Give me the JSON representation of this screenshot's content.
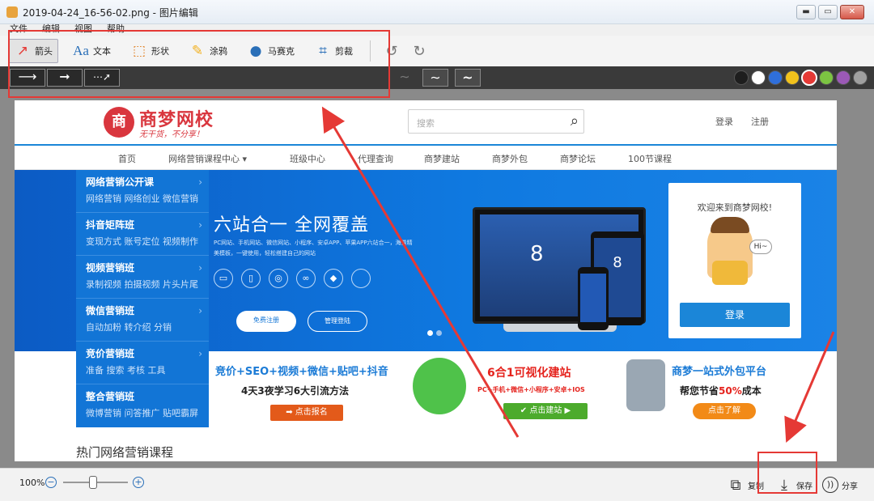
{
  "window": {
    "title": "2019-04-24_16-56-02.png - 图片编辑",
    "buttons": {
      "minimize": "▬",
      "maximize": "▭",
      "close": "✕"
    }
  },
  "menu": [
    "文件",
    "编辑",
    "视图",
    "帮助"
  ],
  "tools": {
    "arrow": "箭头",
    "text": "文本",
    "shape": "形状",
    "brush": "涂鸦",
    "mosaic": "马赛克",
    "crop": "剪裁"
  },
  "icons": {
    "arrow": "arrow-icon",
    "text": "text-icon",
    "shape": "shape-icon",
    "brush": "pencil-icon",
    "mosaic": "droplet-icon",
    "crop": "crop-icon",
    "undo": "undo-icon",
    "redo": "redo-icon"
  },
  "colors": {
    "accent_red": "#e53935",
    "swatches": [
      "#1e1e1e",
      "#ffffff",
      "#2f6fdb",
      "#f2c21c",
      "#e53935",
      "#7cc442",
      "#9b59b6",
      "#a0a0a0"
    ]
  },
  "site": {
    "logo_seal": "商",
    "logo_name": "商梦网校",
    "logo_slogan": "无干货，不分享！",
    "search_placeholder": "搜索",
    "login": "登录",
    "register": "注册",
    "nav": [
      "首页",
      "网络营销课程中心 ▾",
      "班级中心",
      "代理查询",
      "商梦建站",
      "商梦外包",
      "商梦论坛",
      "100节课程"
    ],
    "side_menu": [
      {
        "title": "网络营销公开课",
        "sub": "网络营销  网络创业  微信营销"
      },
      {
        "title": "抖音矩阵班",
        "sub": "变现方式  账号定位  视频制作"
      },
      {
        "title": "视频营销班",
        "sub": "录制视频  拍摄视频  片头片尾"
      },
      {
        "title": "微信营销班",
        "sub": "自动加粉  转介绍  分销"
      },
      {
        "title": "竞价营销班",
        "sub": "准备  搜索  考核  工具"
      },
      {
        "title": "整合营销班",
        "sub": "微博营销  问答推广  贴吧霸屏"
      }
    ],
    "banner": {
      "title": "六站合一  全网覆盖",
      "desc": "PC网站、手机网站、微信网站、小程序、安卓APP、苹果APP六站合一，海量精美模板，一键使用，轻松搭建自己的网站",
      "platforms": [
        "▭",
        "▯",
        "◎",
        "∞",
        "◆",
        ""
      ],
      "btn_primary": "免费注册",
      "btn_secondary": "管理登陆",
      "device_text": "8"
    },
    "welcome": {
      "text": "欢迎来到商梦网校!",
      "hi": "Hi~",
      "login_btn": "登录"
    },
    "promos": [
      {
        "line1": "竞价+SEO+视频+微信+贴吧+抖音",
        "line2": "4天3夜学习6大引流方法",
        "btn": "➡ 点击报名"
      },
      {
        "line1": "6合1可视化建站",
        "line2": "PC+手机+微信+小程序+安卓+IOS",
        "btn": "✔ 点击建站 ▶"
      },
      {
        "line1": "商梦一站式外包平台",
        "line2_pre": "帮您节省",
        "line2_hl": "50%",
        "line2_post": "成本",
        "btn": "点击了解"
      }
    ],
    "hot_courses": "热门网络营销课程"
  },
  "status": {
    "zoom": "100%",
    "zoom_out": "−",
    "zoom_in": "+",
    "copy": "复制",
    "save": "保存",
    "share": "分享"
  }
}
